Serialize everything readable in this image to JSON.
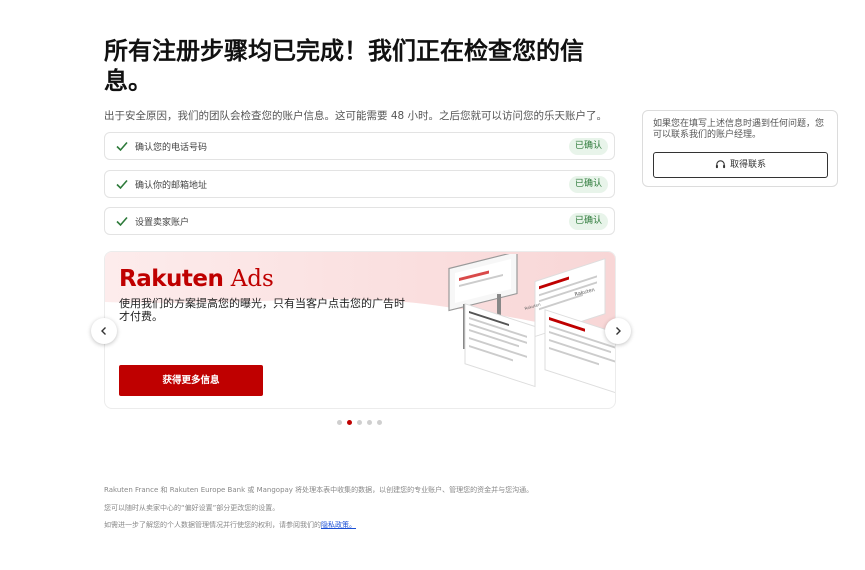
{
  "page": {
    "title": "所有注册步骤均已完成！我们正在检查您的信息。",
    "subtitle": "出于安全原因，我们的团队会检查您的账户信息。这可能需要 48 小时。之后您就可以访问您的乐天账户了。"
  },
  "steps": [
    {
      "label": "确认您的电话号码",
      "status": "已确认"
    },
    {
      "label": "确认你的邮箱地址",
      "status": "已确认"
    },
    {
      "label": "设置卖家账户",
      "status": "已确认"
    }
  ],
  "help": {
    "text": "如果您在填写上述信息时遇到任何问题，您可以联系我们的账户经理。",
    "button_label": "取得联系",
    "button_icon": "headset-icon"
  },
  "banner": {
    "brand_rakuten": "Rakuten",
    "brand_ads": "Ads",
    "text": "使用我们的方案提高您的曝光，只有当客户点击您的广告时才付费。",
    "cta_label": "获得更多信息",
    "prev_icon": "chevron-left-icon",
    "next_icon": "chevron-right-icon",
    "illustration_texts": {
      "card1": "Rakuten",
      "card2": "Rakuten"
    }
  },
  "carousel": {
    "count": 5,
    "active_index": 1
  },
  "footer": {
    "line1": "Rakuten France 和 Rakuten Europe Bank 或 Mangopay 将处理本表中收集的数据，以创建您的专业账户、管理您的资金并与您沟通。",
    "line2": "您可以随时从卖家中心的“偏好设置”部分更改您的设置。",
    "line3_prefix": "如需进一步了解您的个人数据管理情况并行使您的权利，请参阅我们的",
    "line3_link": "隐私政策。"
  },
  "colors": {
    "brand_red": "#bf0000",
    "success_bg": "#e8f4ea",
    "success_text": "#2d7a3a",
    "link": "#1a4fd6"
  }
}
